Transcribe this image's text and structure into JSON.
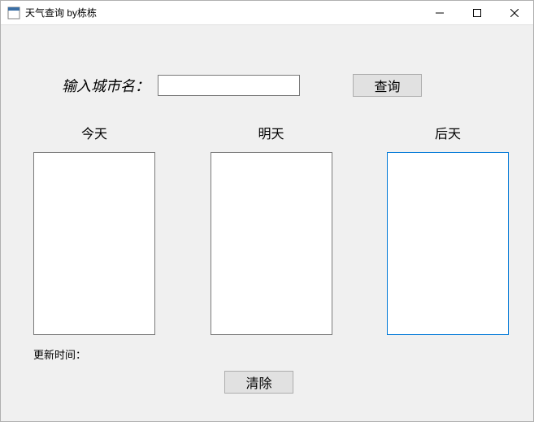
{
  "window": {
    "title": "天气查询 by栋栋"
  },
  "input": {
    "label": "输入城市名：",
    "value": "",
    "query_button": "查询"
  },
  "days": {
    "today": "今天",
    "tomorrow": "明天",
    "day_after": "后天"
  },
  "update_time": {
    "label": "更新时间：",
    "value": ""
  },
  "clear_button": "清除"
}
